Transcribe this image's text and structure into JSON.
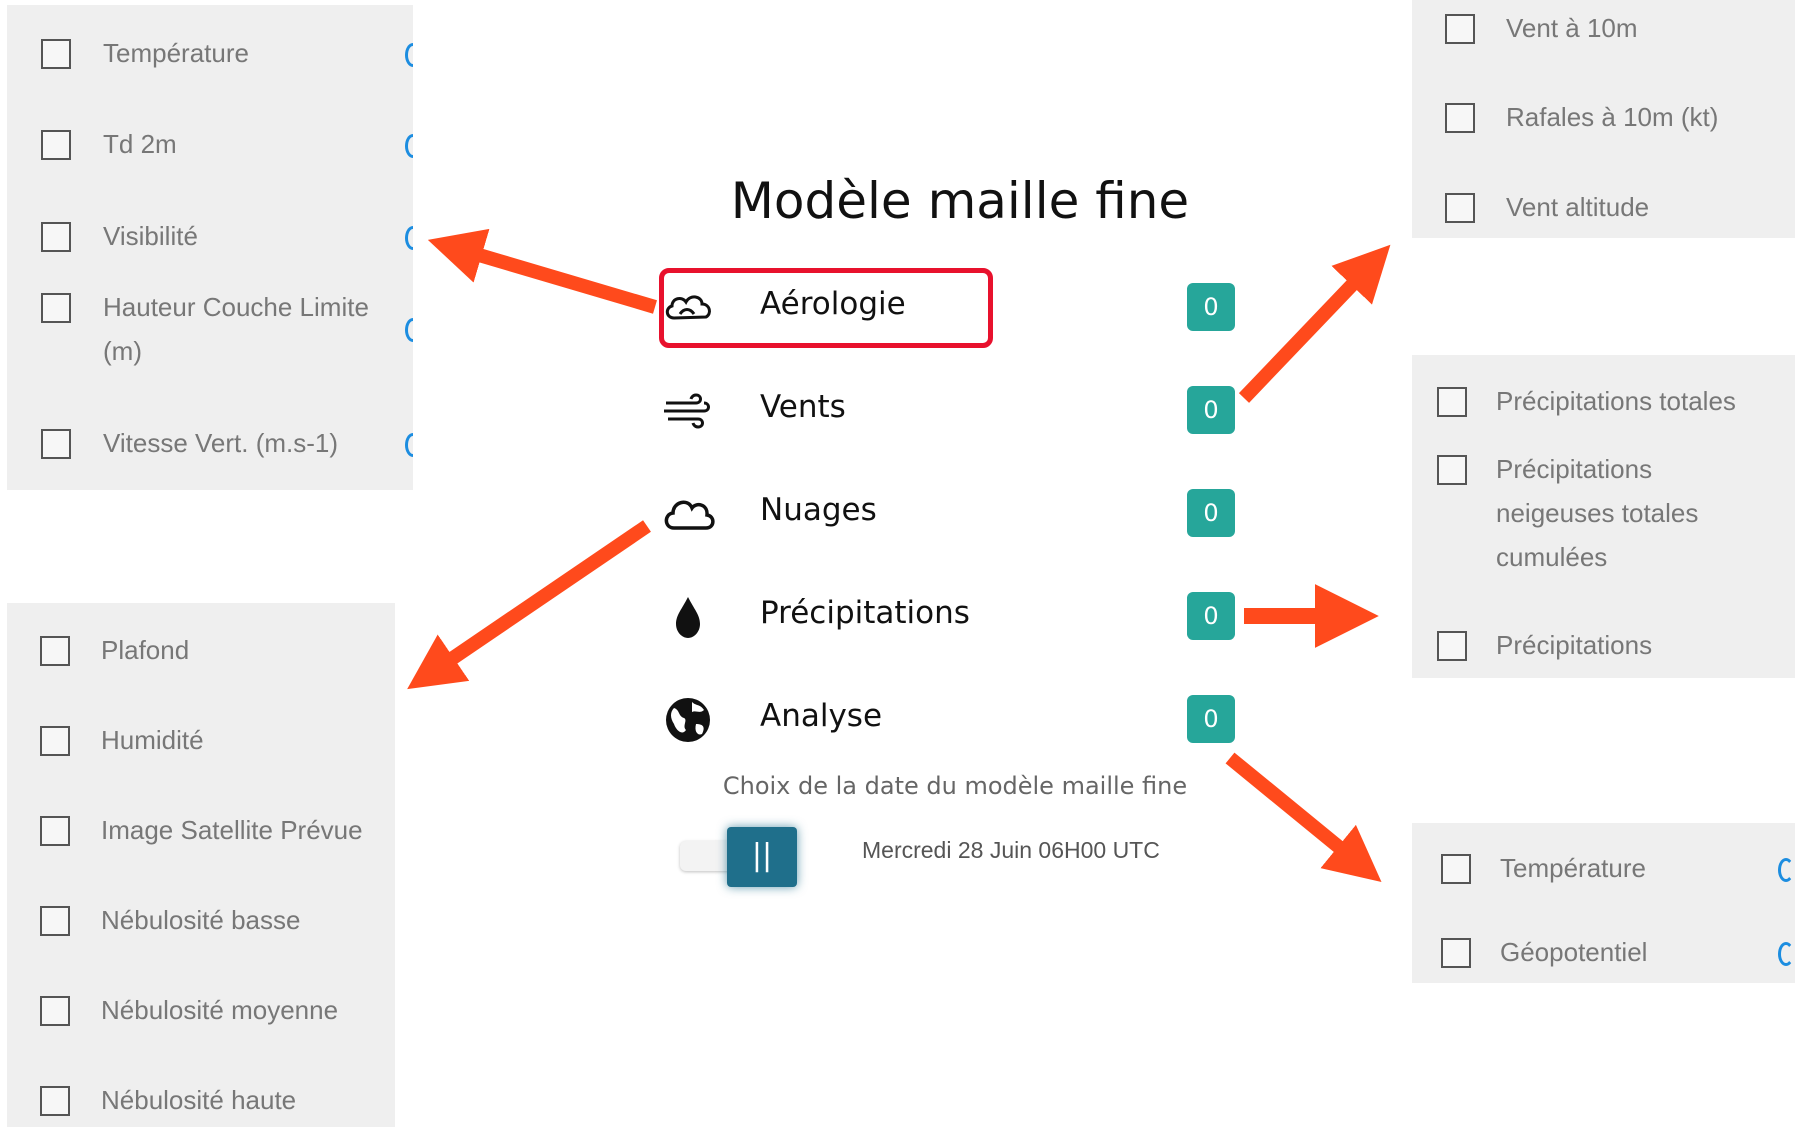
{
  "title": "Modèle maille fine",
  "categories": [
    {
      "label": "Aérologie",
      "icon": "cloud-outline-icon",
      "count": "0"
    },
    {
      "label": "Vents",
      "icon": "wind-icon",
      "count": "0"
    },
    {
      "label": "Nuages",
      "icon": "cloud-icon",
      "count": "0"
    },
    {
      "label": "Précipitations",
      "icon": "raindrop-icon",
      "count": "0"
    },
    {
      "label": "Analyse",
      "icon": "globe-icon",
      "count": "0"
    }
  ],
  "date_picker": {
    "caption": "Choix de la date du modèle maille fine",
    "value": "Mercredi 28 Juin 06H00 UTC",
    "toggle_glyph": "||"
  },
  "panels": {
    "aerologie": [
      "Température",
      "Td 2m",
      "Visibilité",
      "Hauteur Couche Limite (m)",
      "Vitesse Vert. (m.s-1)"
    ],
    "nuages": [
      "Plafond",
      "Humidité",
      "Image Satellite Prévue",
      "Nébulosité basse",
      "Nébulosité moyenne",
      "Nébulosité haute"
    ],
    "vents": [
      "Vent à 10m",
      "Rafales à 10m (kt)",
      "Vent altitude"
    ],
    "precipitations": [
      "Précipitations totales",
      "Précipitations neigeuses totales cumulées",
      "Précipitations"
    ],
    "analyse": [
      "Température",
      "Géopotentiel"
    ]
  },
  "colors": {
    "badge": "#26a69a",
    "highlight": "#e8112d",
    "arrow": "#ff4a1c",
    "panel_bg": "#efefef",
    "info_icon": "#1c8de0"
  }
}
